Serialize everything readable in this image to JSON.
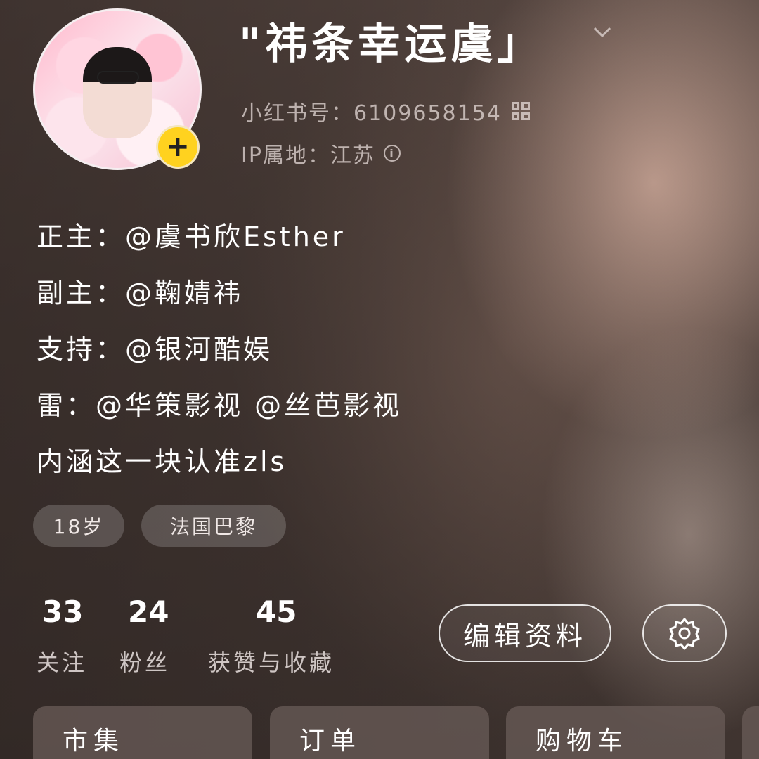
{
  "profile": {
    "display_name": "\"祎条幸运虞」",
    "id_line": "小红书号：6109658154",
    "ip_line": "IP属地：江苏"
  },
  "bio": {
    "lines": [
      "正主：@虞书欣Esther",
      "副主：@鞠婧祎",
      "支持：@银河酷娱",
      "雷：@华策影视 @丝芭影视",
      "内涵这一块认准zls"
    ]
  },
  "tags": [
    "18岁",
    "法国巴黎"
  ],
  "stats": [
    {
      "value": "33",
      "label": "关注"
    },
    {
      "value": "24",
      "label": "粉丝"
    },
    {
      "value": "45",
      "label": "获赞与收藏"
    }
  ],
  "actions": {
    "edit_profile": "编辑资料"
  },
  "cards": [
    "市集",
    "订单",
    "购物车"
  ],
  "icons": {
    "avatar_add": "plus-icon",
    "name_dropdown": "chevron-down-icon",
    "qr": "qr-code-icon",
    "info": "info-icon",
    "settings": "gear-icon"
  },
  "colors": {
    "avatar_badge": "#ffd21f",
    "text_primary": "#ffffff"
  }
}
